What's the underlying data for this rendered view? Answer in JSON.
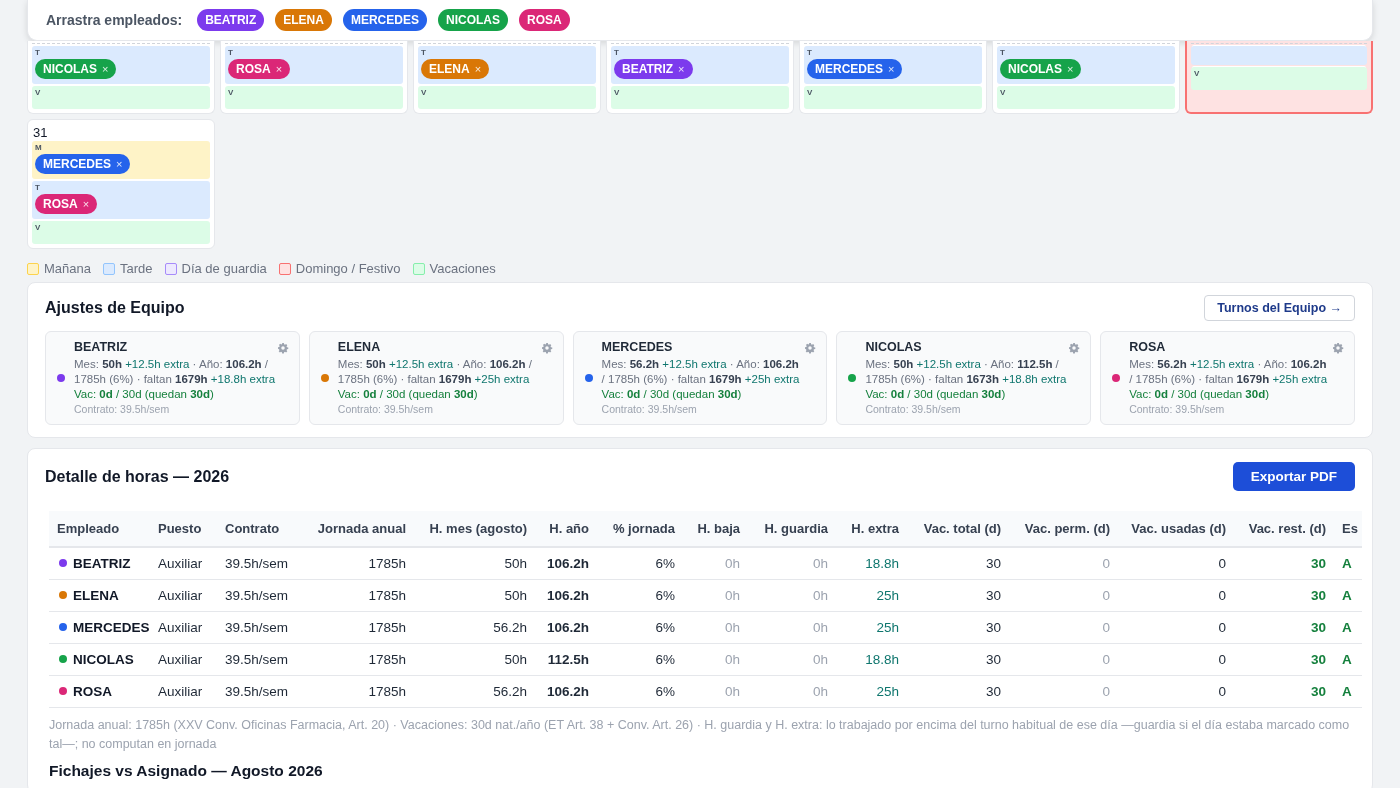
{
  "drag_bar": {
    "label": "Arrastra empleados:",
    "employees": [
      {
        "name": "BEATRIZ",
        "color": "#7c3aed"
      },
      {
        "name": "ELENA",
        "color": "#d97706"
      },
      {
        "name": "MERCEDES",
        "color": "#2563eb"
      },
      {
        "name": "NICOLAS",
        "color": "#16a34a"
      },
      {
        "name": "ROSA",
        "color": "#db2777"
      }
    ]
  },
  "calendar": {
    "weeks": [
      [
        {
          "kind": "workday",
          "slots": [
            {
              "kind": "T",
              "label": "T",
              "chips": [
                {
                  "name": "NICOLAS",
                  "color": "#16a34a",
                  "remove": "×"
                }
              ]
            },
            {
              "kind": "V",
              "label": "V"
            }
          ]
        },
        {
          "kind": "workday",
          "slots": [
            {
              "kind": "T",
              "label": "T",
              "chips": [
                {
                  "name": "ROSA",
                  "color": "#db2777",
                  "remove": "×"
                }
              ]
            },
            {
              "kind": "V",
              "label": "V"
            }
          ]
        },
        {
          "kind": "workday",
          "slots": [
            {
              "kind": "T",
              "label": "T",
              "chips": [
                {
                  "name": "ELENA",
                  "color": "#d97706",
                  "remove": "×"
                }
              ]
            },
            {
              "kind": "V",
              "label": "V"
            }
          ]
        },
        {
          "kind": "workday",
          "slots": [
            {
              "kind": "T",
              "label": "T",
              "chips": [
                {
                  "name": "BEATRIZ",
                  "color": "#7c3aed",
                  "remove": "×"
                }
              ]
            },
            {
              "kind": "V",
              "label": "V"
            }
          ]
        },
        {
          "kind": "workday",
          "slots": [
            {
              "kind": "T",
              "label": "T",
              "chips": [
                {
                  "name": "MERCEDES",
                  "color": "#2563eb",
                  "remove": "×"
                }
              ]
            },
            {
              "kind": "V",
              "label": "V"
            }
          ]
        },
        {
          "kind": "workday",
          "slots": [
            {
              "kind": "T",
              "label": "T",
              "chips": [
                {
                  "name": "NICOLAS",
                  "color": "#16a34a",
                  "remove": "×"
                }
              ]
            },
            {
              "kind": "V",
              "label": "V"
            }
          ]
        },
        {
          "kind": "holiday",
          "slots": [
            {
              "kind": "T"
            },
            {
              "kind": "V",
              "label": "V"
            }
          ]
        }
      ],
      [
        {
          "kind": "workday",
          "day": "31",
          "slots": [
            {
              "kind": "M",
              "label": "M",
              "chips": [
                {
                  "name": "MERCEDES",
                  "color": "#2563eb",
                  "remove": "×"
                }
              ]
            },
            {
              "kind": "T",
              "label": "T",
              "chips": [
                {
                  "name": "ROSA",
                  "color": "#db2777",
                  "remove": "×"
                }
              ]
            },
            {
              "kind": "V",
              "label": "V"
            }
          ]
        }
      ]
    ]
  },
  "legend": [
    {
      "kind": "M",
      "label": "Mañana"
    },
    {
      "kind": "T",
      "label": "Tarde"
    },
    {
      "kind": "G",
      "label": "Día de guardia"
    },
    {
      "kind": "F",
      "label": "Domingo / Festivo"
    },
    {
      "kind": "V",
      "label": "Vacaciones"
    }
  ],
  "team": {
    "title": "Ajustes de Equipo",
    "button": "Turnos del Equipo →",
    "members": [
      {
        "name": "BEATRIZ",
        "color": "#7c3aed",
        "stats": [
          {
            "text": "Mes: ",
            "kind": "plain"
          },
          {
            "text": "50h",
            "kind": "bold"
          },
          {
            "text": " +12.5h extra",
            "kind": "extra"
          },
          {
            "text": " · Año: ",
            "kind": "plain"
          },
          {
            "text": "106.2h",
            "kind": "bold"
          },
          {
            "text": " / 1785h (6%)  · faltan ",
            "kind": "plain"
          },
          {
            "text": "1679h",
            "kind": "bold"
          },
          {
            "text": "  +18.8h extra",
            "kind": "extra"
          }
        ],
        "vacation": "Vac: **0d** / 30d (quedan **30d**)",
        "contract": "Contrato: 39.5h/sem"
      },
      {
        "name": "ELENA",
        "color": "#d97706",
        "stats": [
          {
            "text": "Mes: ",
            "kind": "plain"
          },
          {
            "text": "50h",
            "kind": "bold"
          },
          {
            "text": " +12.5h extra",
            "kind": "extra"
          },
          {
            "text": " · Año: ",
            "kind": "plain"
          },
          {
            "text": "106.2h",
            "kind": "bold"
          },
          {
            "text": " / 1785h (6%)  · faltan ",
            "kind": "plain"
          },
          {
            "text": "1679h",
            "kind": "bold"
          },
          {
            "text": "  +25h extra",
            "kind": "extra"
          }
        ],
        "vacation": "Vac: **0d** / 30d (quedan **30d**)",
        "contract": "Contrato: 39.5h/sem"
      },
      {
        "name": "MERCEDES",
        "color": "#2563eb",
        "stats": [
          {
            "text": "Mes: ",
            "kind": "plain"
          },
          {
            "text": "56.2h",
            "kind": "bold"
          },
          {
            "text": " +12.5h extra",
            "kind": "extra"
          },
          {
            "text": " · Año: ",
            "kind": "plain"
          },
          {
            "text": "106.2h",
            "kind": "bold"
          },
          {
            "text": " / 1785h (6%)  · faltan ",
            "kind": "plain"
          },
          {
            "text": "1679h",
            "kind": "bold"
          },
          {
            "text": "  +25h extra",
            "kind": "extra"
          }
        ],
        "vacation": "Vac: **0d** / 30d (quedan **30d**)",
        "contract": "Contrato: 39.5h/sem"
      },
      {
        "name": "NICOLAS",
        "color": "#16a34a",
        "stats": [
          {
            "text": "Mes: ",
            "kind": "plain"
          },
          {
            "text": "50h",
            "kind": "bold"
          },
          {
            "text": " +12.5h extra",
            "kind": "extra"
          },
          {
            "text": " · Año: ",
            "kind": "plain"
          },
          {
            "text": "112.5h",
            "kind": "bold"
          },
          {
            "text": " / 1785h (6%)  · faltan ",
            "kind": "plain"
          },
          {
            "text": "1673h",
            "kind": "bold"
          },
          {
            "text": "  +18.8h extra",
            "kind": "extra"
          }
        ],
        "vacation": "Vac: **0d** / 30d (quedan **30d**)",
        "contract": "Contrato: 39.5h/sem"
      },
      {
        "name": "ROSA",
        "color": "#db2777",
        "stats": [
          {
            "text": "Mes: ",
            "kind": "plain"
          },
          {
            "text": "56.2h",
            "kind": "bold"
          },
          {
            "text": " +12.5h extra",
            "kind": "extra"
          },
          {
            "text": " · Año: ",
            "kind": "plain"
          },
          {
            "text": "106.2h",
            "kind": "bold"
          },
          {
            "text": " / 1785h (6%)  · faltan ",
            "kind": "plain"
          },
          {
            "text": "1679h",
            "kind": "bold"
          },
          {
            "text": "  +25h extra",
            "kind": "extra"
          }
        ],
        "vacation": "Vac: **0d** / 30d (quedan **30d**)",
        "contract": "Contrato: 39.5h/sem"
      }
    ]
  },
  "hours": {
    "title": "Detalle de horas — 2026",
    "button": "Exportar PDF",
    "table": {
      "columns": [
        "Empleado",
        "Puesto",
        "Contrato",
        "Jornada anual",
        "H. mes (agosto)",
        "H. año",
        "% jornada",
        "H. baja",
        "H. guardia",
        "H. extra",
        "Vac. total (d)",
        "Vac. perm. (d)",
        "Vac. usadas (d)",
        "Vac. rest. (d)",
        "Es"
      ],
      "rows": [
        {
          "color": "#7c3aed",
          "cells": [
            "BEATRIZ",
            "Auxiliar",
            "39.5h/sem",
            "1785h",
            "50h",
            "106.2h",
            "6%",
            "0h",
            "0h",
            "18.8h",
            "30",
            "0",
            "0",
            "30",
            "A"
          ]
        },
        {
          "color": "#d97706",
          "cells": [
            "ELENA",
            "Auxiliar",
            "39.5h/sem",
            "1785h",
            "50h",
            "106.2h",
            "6%",
            "0h",
            "0h",
            "25h",
            "30",
            "0",
            "0",
            "30",
            "A"
          ]
        },
        {
          "color": "#2563eb",
          "cells": [
            "MERCEDES",
            "Auxiliar",
            "39.5h/sem",
            "1785h",
            "56.2h",
            "106.2h",
            "6%",
            "0h",
            "0h",
            "25h",
            "30",
            "0",
            "0",
            "30",
            "A"
          ]
        },
        {
          "color": "#16a34a",
          "cells": [
            "NICOLAS",
            "Auxiliar",
            "39.5h/sem",
            "1785h",
            "50h",
            "112.5h",
            "6%",
            "0h",
            "0h",
            "18.8h",
            "30",
            "0",
            "0",
            "30",
            "A"
          ]
        },
        {
          "color": "#db2777",
          "cells": [
            "ROSA",
            "Auxiliar",
            "39.5h/sem",
            "1785h",
            "56.2h",
            "106.2h",
            "6%",
            "0h",
            "0h",
            "25h",
            "30",
            "0",
            "0",
            "30",
            "A"
          ]
        }
      ]
    },
    "footnote": "Jornada anual: 1785h (XXV Conv. Oficinas Farmacia, Art. 20) · Vacaciones: 30d nat./año (ET Art. 38 + Conv. Art. 26) · H. guardia y H. extra: lo trabajado por encima del turno habitual de ese día —guardia si el día estaba marcado como tal—; no computan en jornada"
  },
  "next_section": {
    "title": "Fichajes vs Asignado — Agosto 2026"
  }
}
